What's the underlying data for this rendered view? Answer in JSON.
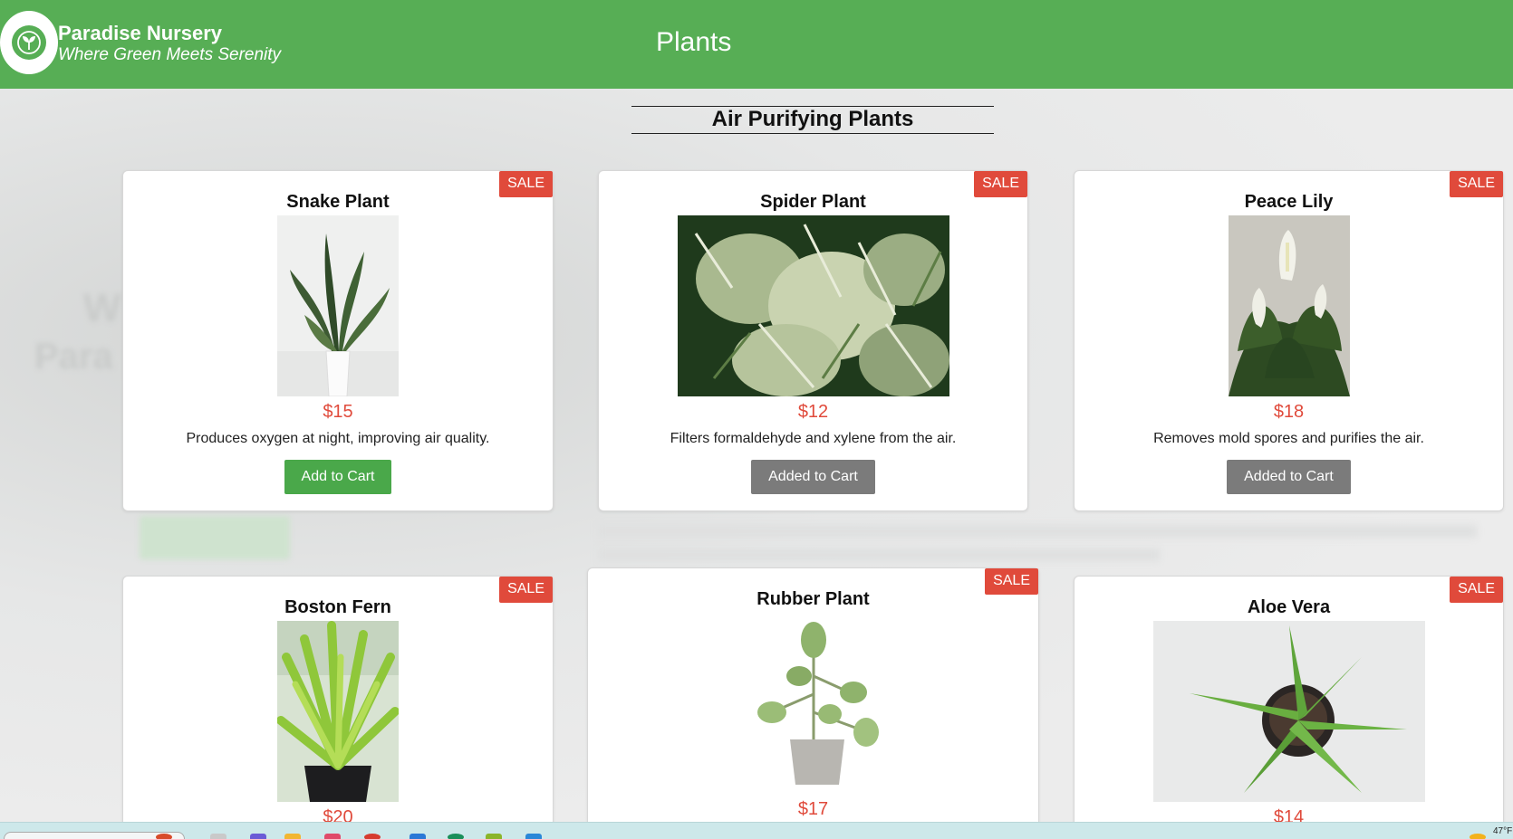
{
  "header": {
    "brand_name": "Paradise Nursery",
    "tagline": "Where Green Meets Serenity",
    "nav_title": "Plants"
  },
  "section": {
    "title": "Air Purifying Plants"
  },
  "plants": [
    {
      "name": "Snake Plant",
      "badge": "SALE",
      "price": "$15",
      "description": "Produces oxygen at night, improving air quality.",
      "button": "Add to Cart",
      "in_cart": false
    },
    {
      "name": "Spider Plant",
      "badge": "SALE",
      "price": "$12",
      "description": "Filters formaldehyde and xylene from the air.",
      "button": "Added to Cart",
      "in_cart": true
    },
    {
      "name": "Peace Lily",
      "badge": "SALE",
      "price": "$18",
      "description": "Removes mold spores and purifies the air.",
      "button": "Added to Cart",
      "in_cart": true
    },
    {
      "name": "Boston Fern",
      "badge": "SALE",
      "price": "$20"
    },
    {
      "name": "Rubber Plant",
      "badge": "SALE",
      "price": "$17"
    },
    {
      "name": "Aloe Vera",
      "badge": "SALE",
      "price": "$14"
    }
  ],
  "taskbar": {
    "weather": "47°F"
  },
  "colors": {
    "header_green": "#57ae55",
    "sale_red": "#e04a3b",
    "add_green": "#4aa84a",
    "added_grey": "#7b7b7b"
  }
}
